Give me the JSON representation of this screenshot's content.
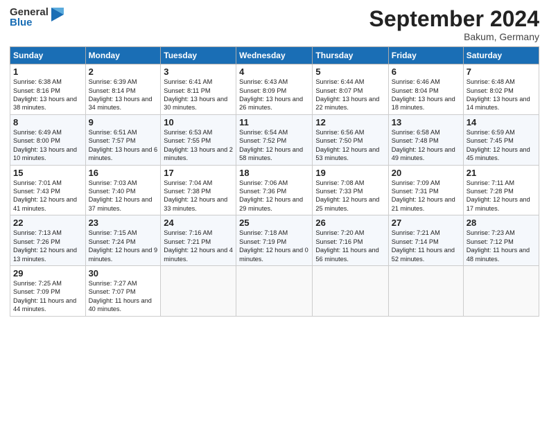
{
  "header": {
    "logo_general": "General",
    "logo_blue": "Blue",
    "month_year": "September 2024",
    "location": "Bakum, Germany"
  },
  "columns": [
    "Sunday",
    "Monday",
    "Tuesday",
    "Wednesday",
    "Thursday",
    "Friday",
    "Saturday"
  ],
  "weeks": [
    [
      {
        "day": "1",
        "sunrise": "6:38 AM",
        "sunset": "8:16 PM",
        "daylight": "13 hours and 38 minutes."
      },
      {
        "day": "2",
        "sunrise": "6:39 AM",
        "sunset": "8:14 PM",
        "daylight": "13 hours and 34 minutes."
      },
      {
        "day": "3",
        "sunrise": "6:41 AM",
        "sunset": "8:11 PM",
        "daylight": "13 hours and 30 minutes."
      },
      {
        "day": "4",
        "sunrise": "6:43 AM",
        "sunset": "8:09 PM",
        "daylight": "13 hours and 26 minutes."
      },
      {
        "day": "5",
        "sunrise": "6:44 AM",
        "sunset": "8:07 PM",
        "daylight": "13 hours and 22 minutes."
      },
      {
        "day": "6",
        "sunrise": "6:46 AM",
        "sunset": "8:04 PM",
        "daylight": "13 hours and 18 minutes."
      },
      {
        "day": "7",
        "sunrise": "6:48 AM",
        "sunset": "8:02 PM",
        "daylight": "13 hours and 14 minutes."
      }
    ],
    [
      {
        "day": "8",
        "sunrise": "6:49 AM",
        "sunset": "8:00 PM",
        "daylight": "13 hours and 10 minutes."
      },
      {
        "day": "9",
        "sunrise": "6:51 AM",
        "sunset": "7:57 PM",
        "daylight": "13 hours and 6 minutes."
      },
      {
        "day": "10",
        "sunrise": "6:53 AM",
        "sunset": "7:55 PM",
        "daylight": "13 hours and 2 minutes."
      },
      {
        "day": "11",
        "sunrise": "6:54 AM",
        "sunset": "7:52 PM",
        "daylight": "12 hours and 58 minutes."
      },
      {
        "day": "12",
        "sunrise": "6:56 AM",
        "sunset": "7:50 PM",
        "daylight": "12 hours and 53 minutes."
      },
      {
        "day": "13",
        "sunrise": "6:58 AM",
        "sunset": "7:48 PM",
        "daylight": "12 hours and 49 minutes."
      },
      {
        "day": "14",
        "sunrise": "6:59 AM",
        "sunset": "7:45 PM",
        "daylight": "12 hours and 45 minutes."
      }
    ],
    [
      {
        "day": "15",
        "sunrise": "7:01 AM",
        "sunset": "7:43 PM",
        "daylight": "12 hours and 41 minutes."
      },
      {
        "day": "16",
        "sunrise": "7:03 AM",
        "sunset": "7:40 PM",
        "daylight": "12 hours and 37 minutes."
      },
      {
        "day": "17",
        "sunrise": "7:04 AM",
        "sunset": "7:38 PM",
        "daylight": "12 hours and 33 minutes."
      },
      {
        "day": "18",
        "sunrise": "7:06 AM",
        "sunset": "7:36 PM",
        "daylight": "12 hours and 29 minutes."
      },
      {
        "day": "19",
        "sunrise": "7:08 AM",
        "sunset": "7:33 PM",
        "daylight": "12 hours and 25 minutes."
      },
      {
        "day": "20",
        "sunrise": "7:09 AM",
        "sunset": "7:31 PM",
        "daylight": "12 hours and 21 minutes."
      },
      {
        "day": "21",
        "sunrise": "7:11 AM",
        "sunset": "7:28 PM",
        "daylight": "12 hours and 17 minutes."
      }
    ],
    [
      {
        "day": "22",
        "sunrise": "7:13 AM",
        "sunset": "7:26 PM",
        "daylight": "12 hours and 13 minutes."
      },
      {
        "day": "23",
        "sunrise": "7:15 AM",
        "sunset": "7:24 PM",
        "daylight": "12 hours and 9 minutes."
      },
      {
        "day": "24",
        "sunrise": "7:16 AM",
        "sunset": "7:21 PM",
        "daylight": "12 hours and 4 minutes."
      },
      {
        "day": "25",
        "sunrise": "7:18 AM",
        "sunset": "7:19 PM",
        "daylight": "12 hours and 0 minutes."
      },
      {
        "day": "26",
        "sunrise": "7:20 AM",
        "sunset": "7:16 PM",
        "daylight": "11 hours and 56 minutes."
      },
      {
        "day": "27",
        "sunrise": "7:21 AM",
        "sunset": "7:14 PM",
        "daylight": "11 hours and 52 minutes."
      },
      {
        "day": "28",
        "sunrise": "7:23 AM",
        "sunset": "7:12 PM",
        "daylight": "11 hours and 48 minutes."
      }
    ],
    [
      {
        "day": "29",
        "sunrise": "7:25 AM",
        "sunset": "7:09 PM",
        "daylight": "11 hours and 44 minutes."
      },
      {
        "day": "30",
        "sunrise": "7:27 AM",
        "sunset": "7:07 PM",
        "daylight": "11 hours and 40 minutes."
      },
      null,
      null,
      null,
      null,
      null
    ]
  ]
}
